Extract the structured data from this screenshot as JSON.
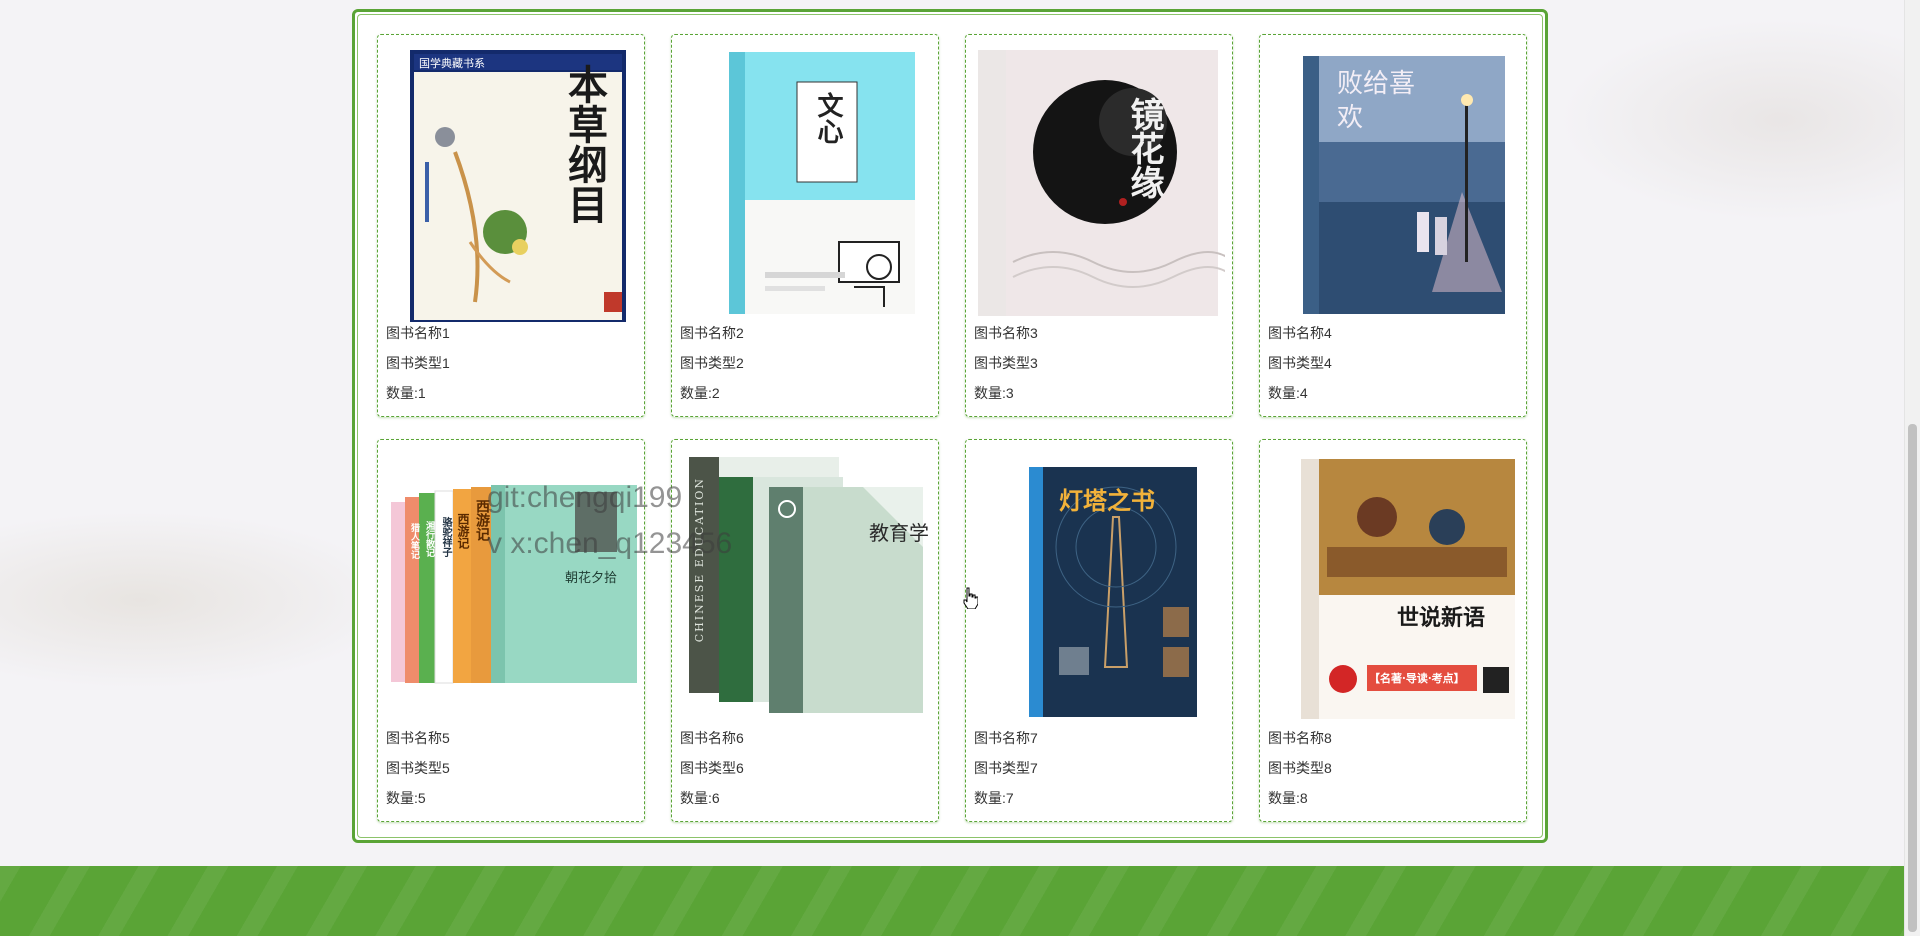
{
  "books": [
    {
      "name": "图书名称1",
      "type": "图书类型1",
      "qty": "数量:1",
      "cover_title": "本草纲目",
      "cover_series": "国学典藏书系"
    },
    {
      "name": "图书名称2",
      "type": "图书类型2",
      "qty": "数量:2",
      "cover_title": "文心"
    },
    {
      "name": "图书名称3",
      "type": "图书类型3",
      "qty": "数量:3",
      "cover_title": "镜花缘"
    },
    {
      "name": "图书名称4",
      "type": "图书类型4",
      "qty": "数量:4",
      "cover_title": "败给喜欢"
    },
    {
      "name": "图书名称5",
      "type": "图书类型5",
      "qty": "数量:5",
      "cover_title": "朝花夕拾",
      "cover_spines": [
        "西游记",
        "西游记",
        "骆驼祥子",
        "湘行散记",
        "猎人笔记"
      ]
    },
    {
      "name": "图书名称6",
      "type": "图书类型6",
      "qty": "数量:6",
      "cover_title": "教育学",
      "cover_spine": "CHINESE EDUCATION"
    },
    {
      "name": "图书名称7",
      "type": "图书类型7",
      "qty": "数量:7",
      "cover_title": "灯塔之书"
    },
    {
      "name": "图书名称8",
      "type": "图书类型8",
      "qty": "数量:8",
      "cover_title": "世说新语",
      "cover_badge": "【名著·导读·考点】"
    }
  ],
  "watermark": {
    "line1": "git:chengqi199",
    "line2": "v x:chen_q123456"
  },
  "colors": {
    "accent": "#5aa436",
    "footer": "#5aa436"
  }
}
